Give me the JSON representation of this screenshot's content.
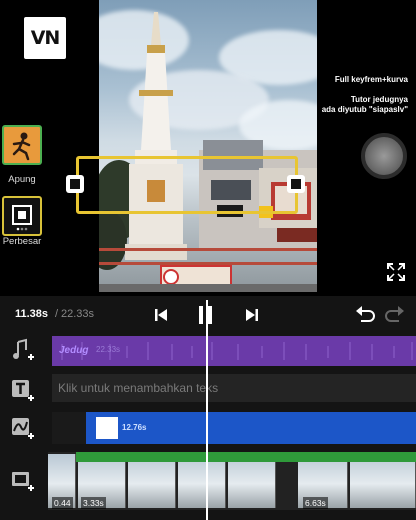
{
  "app": {
    "logo_text": "VN"
  },
  "effects": [
    {
      "label": "Apung"
    },
    {
      "label": "Perbesar"
    }
  ],
  "preview": {
    "caption_line1": "Full keyfrem+kurva",
    "caption_line2": "Tutor jedugnya",
    "caption_line3": "ada diyutub \"siapaslv\""
  },
  "transport": {
    "current_time": "11.38s",
    "separator": "/",
    "total_time": "22.33s"
  },
  "tracks": {
    "music": {
      "name": "Jedug",
      "duration": "22.33s"
    },
    "text": {
      "placeholder": "Klik untuk menambahkan teks"
    },
    "fx": {
      "duration": "12.76s"
    },
    "video": {
      "left_clip_duration": "0.44",
      "clip_duration": "3.33s",
      "right_clip_duration": "6.63s"
    }
  },
  "icons": {
    "music": "music-note-icon",
    "text": "text-icon",
    "fx": "fx-curve-icon",
    "video": "film-icon",
    "undo": "undo-icon",
    "redo": "redo-icon"
  },
  "colors": {
    "music_track": "#6a3aa8",
    "fx_track": "#1c56c8",
    "selection": "#e8c532",
    "record": "#7a7a7a"
  }
}
